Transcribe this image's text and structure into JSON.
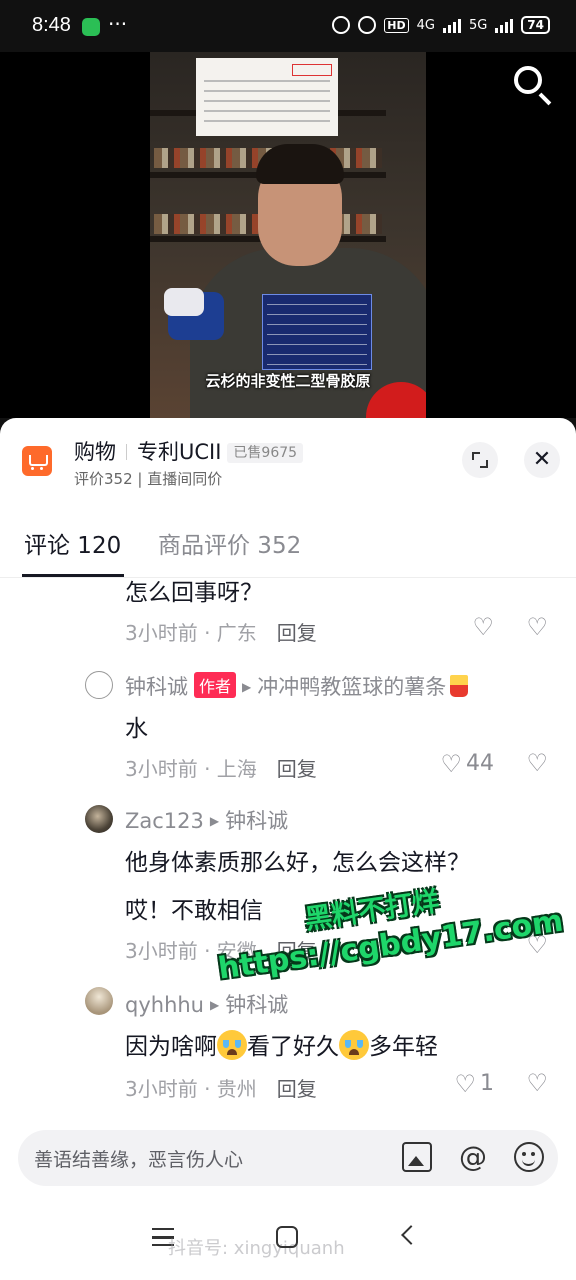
{
  "status_bar": {
    "time": "8:48",
    "more": "···",
    "network": "4G",
    "network2": "5G",
    "hd": "HD",
    "battery": "74"
  },
  "video": {
    "subtitle": "云杉的非变性二型骨胶原"
  },
  "shop": {
    "category": "购物",
    "product": "专利UCII",
    "sold": "已售9675",
    "sub": "评价352 | 直播间同价"
  },
  "tabs": [
    {
      "label": "评论 120"
    },
    {
      "label": "商品评价 352"
    }
  ],
  "comments": [
    {
      "text": "怎么回事呀？",
      "time": "3小时前 · 广东",
      "reply": "回复"
    },
    {
      "author": "钟科诚",
      "badge": "作者",
      "reply_to": "冲冲鸭教篮球的薯条",
      "text": "水",
      "time": "3小时前 · 上海",
      "reply": "回复",
      "likes": "44"
    },
    {
      "author": "Zac123",
      "reply_to": "钟科诚",
      "text_line1": "他身体素质那么好，怎么会这样？",
      "text_line2": "哎！不敢相信",
      "time": "3小时前 · 安徽",
      "reply": "回复"
    },
    {
      "author": "qyhhhu",
      "reply_to": "钟科诚",
      "text_a": "因为啥啊",
      "text_b": "看了好久",
      "text_c": "多年轻",
      "time": "3小时前 · 贵州",
      "reply": "回复",
      "likes": "1"
    }
  ],
  "input": {
    "placeholder": "善语结善缘，恶言伤人心"
  },
  "nav": {
    "watermark": "抖音号: xingyiquanh"
  },
  "promo": {
    "line1": "黑料不打烊",
    "line2": "https://cgbdy17.com"
  },
  "icons": {
    "search": "search-icon",
    "expand": "expand-icon",
    "close": "close-icon",
    "image": "image-icon",
    "at": "at-icon",
    "emoji": "emoji-icon"
  },
  "colors": {
    "brand_red": "#fe2c55",
    "shop_orange": "#fe6a2b",
    "promo_green": "#1ed66a"
  }
}
